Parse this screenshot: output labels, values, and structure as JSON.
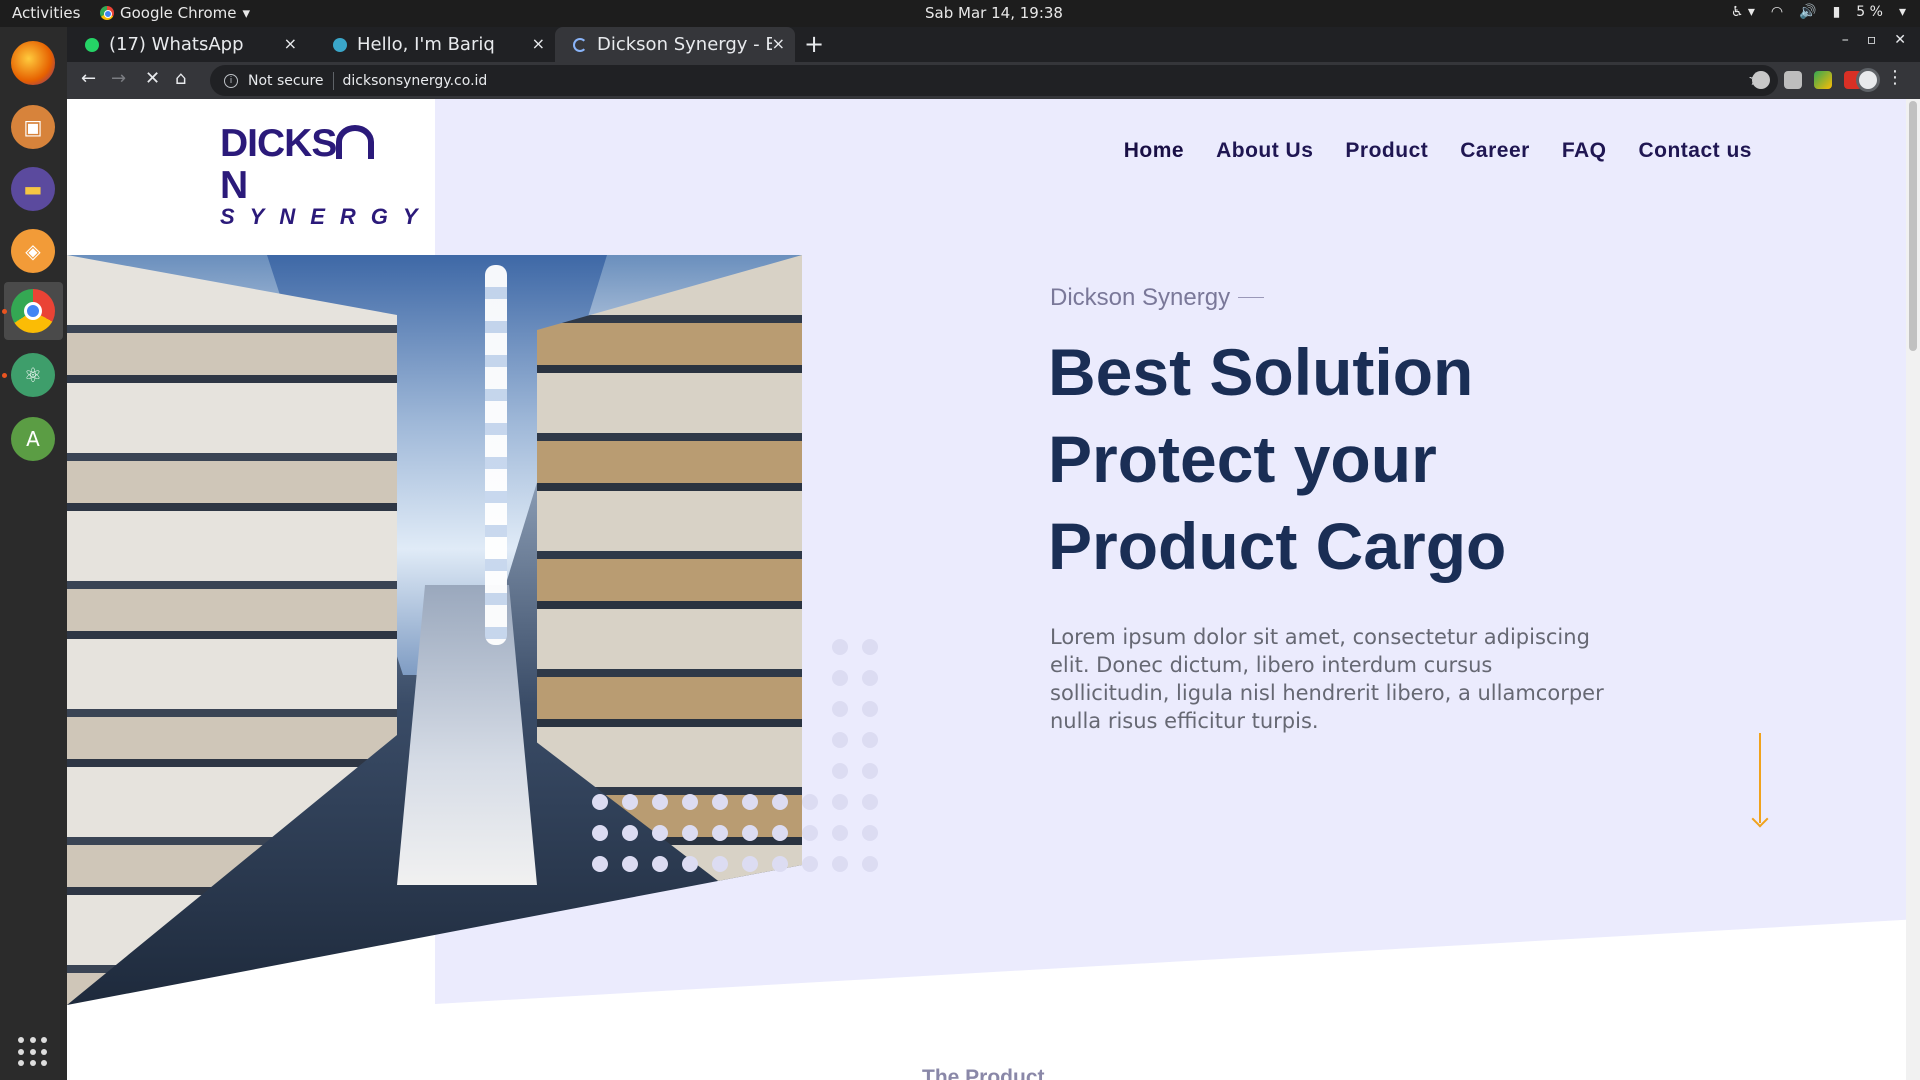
{
  "os": {
    "activities": "Activities",
    "app_menu": "Google Chrome",
    "clock": "Sab Mar 14, 19:38",
    "battery": "5 %"
  },
  "browser": {
    "tabs": [
      {
        "title": "(17) WhatsApp",
        "favicon_color": "#25d366"
      },
      {
        "title": "Hello, I'm Bariq",
        "favicon_color": "#3aa6c9"
      },
      {
        "title": "Dickson Synergy - Be",
        "favicon_color": "#2b1a7a"
      }
    ],
    "address": {
      "security": "Not secure",
      "url": "dicksonsynergy.co.id"
    }
  },
  "site": {
    "logo": {
      "line1": "DICKSON",
      "line2": "SYNERGY"
    },
    "nav": [
      {
        "label": "Home",
        "active": true
      },
      {
        "label": "About Us"
      },
      {
        "label": "Product"
      },
      {
        "label": "Career"
      },
      {
        "label": "FAQ"
      },
      {
        "label": "Contact us"
      }
    ],
    "hero": {
      "eyebrow": "Dickson Synergy",
      "headline_1": "Best Solution",
      "headline_2": "Protect your",
      "headline_3": "Product Cargo",
      "lead": "Lorem ipsum dolor sit amet, consectetur adipiscing elit. Donec dictum, libero interdum cursus sollicitudin, ligula nisl hendrerit libero, a ullamcorper nulla risus efficitur turpis."
    },
    "next_section_label": "The Product"
  },
  "colors": {
    "hero_bg": "#ebebfd",
    "brand": "#2b1a7a",
    "headline": "#1a2e55",
    "accent_arrow": "#f0a21c"
  }
}
